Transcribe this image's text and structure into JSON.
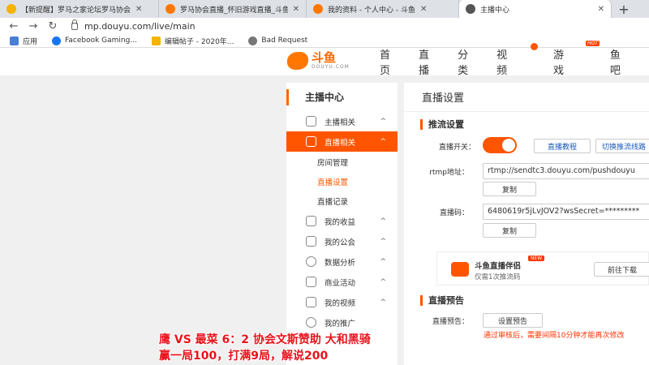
{
  "tabs": [
    {
      "title": "【新提醒】罗马之家论坛罗马协会",
      "color": "#f4b400"
    },
    {
      "title": "罗马协会直播_怀旧游戏直播_斗鱼",
      "color": "#ff7700"
    },
    {
      "title": "我的资料 - 个人中心 - 斗鱼",
      "color": "#ff7700"
    },
    {
      "title": "主播中心",
      "color": "#555555"
    }
  ],
  "address": {
    "url": "mp.douyu.com/live/main"
  },
  "bookmarks": [
    {
      "label": "应用",
      "color": "#4a7fd6"
    },
    {
      "label": "Facebook Gaming...",
      "color": "#1877f2"
    },
    {
      "label": "编辑帖子 - 2020年...",
      "color": "#f4b400"
    },
    {
      "label": "Bad Request",
      "color": "#777777"
    }
  ],
  "header": {
    "logo_name": "斗鱼",
    "logo_sub": "DOUYU.COM",
    "nav": [
      "首页",
      "直播",
      "分类",
      "视频",
      "游戏",
      "鱼吧"
    ],
    "hot_badge": "HOT"
  },
  "sidebar": {
    "title": "主播中心",
    "items": [
      {
        "label": "主播相关",
        "chev": "^"
      },
      {
        "label": "直播相关",
        "chev": "^"
      },
      {
        "label": "我的收益",
        "chev": "^"
      },
      {
        "label": "我的公会",
        "chev": "^"
      },
      {
        "label": "数据分析",
        "chev": "^"
      },
      {
        "label": "商业活动",
        "chev": "^"
      },
      {
        "label": "我的视频",
        "chev": "^"
      },
      {
        "label": "我的推广",
        "chev": ""
      }
    ],
    "subitems": [
      "房间管理",
      "直播设置",
      "直播记录"
    ]
  },
  "main": {
    "title": "直播设置",
    "section_stream": "推流设置",
    "switch_label": "直播开关：",
    "tutorial_button": "直播教程",
    "switch_line_button": "切换推流线路",
    "rtmp_label": "rtmp地址：",
    "rtmp_value": "rtmp://sendtc3.douyu.com/pushdouyu",
    "copy_label": "复制",
    "code_label": "直播码：",
    "code_value": "6480619r5jLvJOV2?wsSecret=*********",
    "promo_name": "斗鱼直播伴侣",
    "promo_desc": "仅需1次推流码",
    "promo_new": "NEW",
    "promo_button": "前往下载",
    "section_preview": "直播预告",
    "preview_label": "直播预告：",
    "preview_button": "设置预告",
    "warning": "通过审核后，需要间隔10分钟才能再次修改"
  },
  "overlay": {
    "line1": "鹰  VS  最菜    6：2  协会文斯赞助 大和黑骑",
    "line2": "赢一局100，打满9局，解说200"
  },
  "colors": {
    "accent": "#ff5500",
    "brand": "#ff7700",
    "caption": "#e8121b"
  }
}
